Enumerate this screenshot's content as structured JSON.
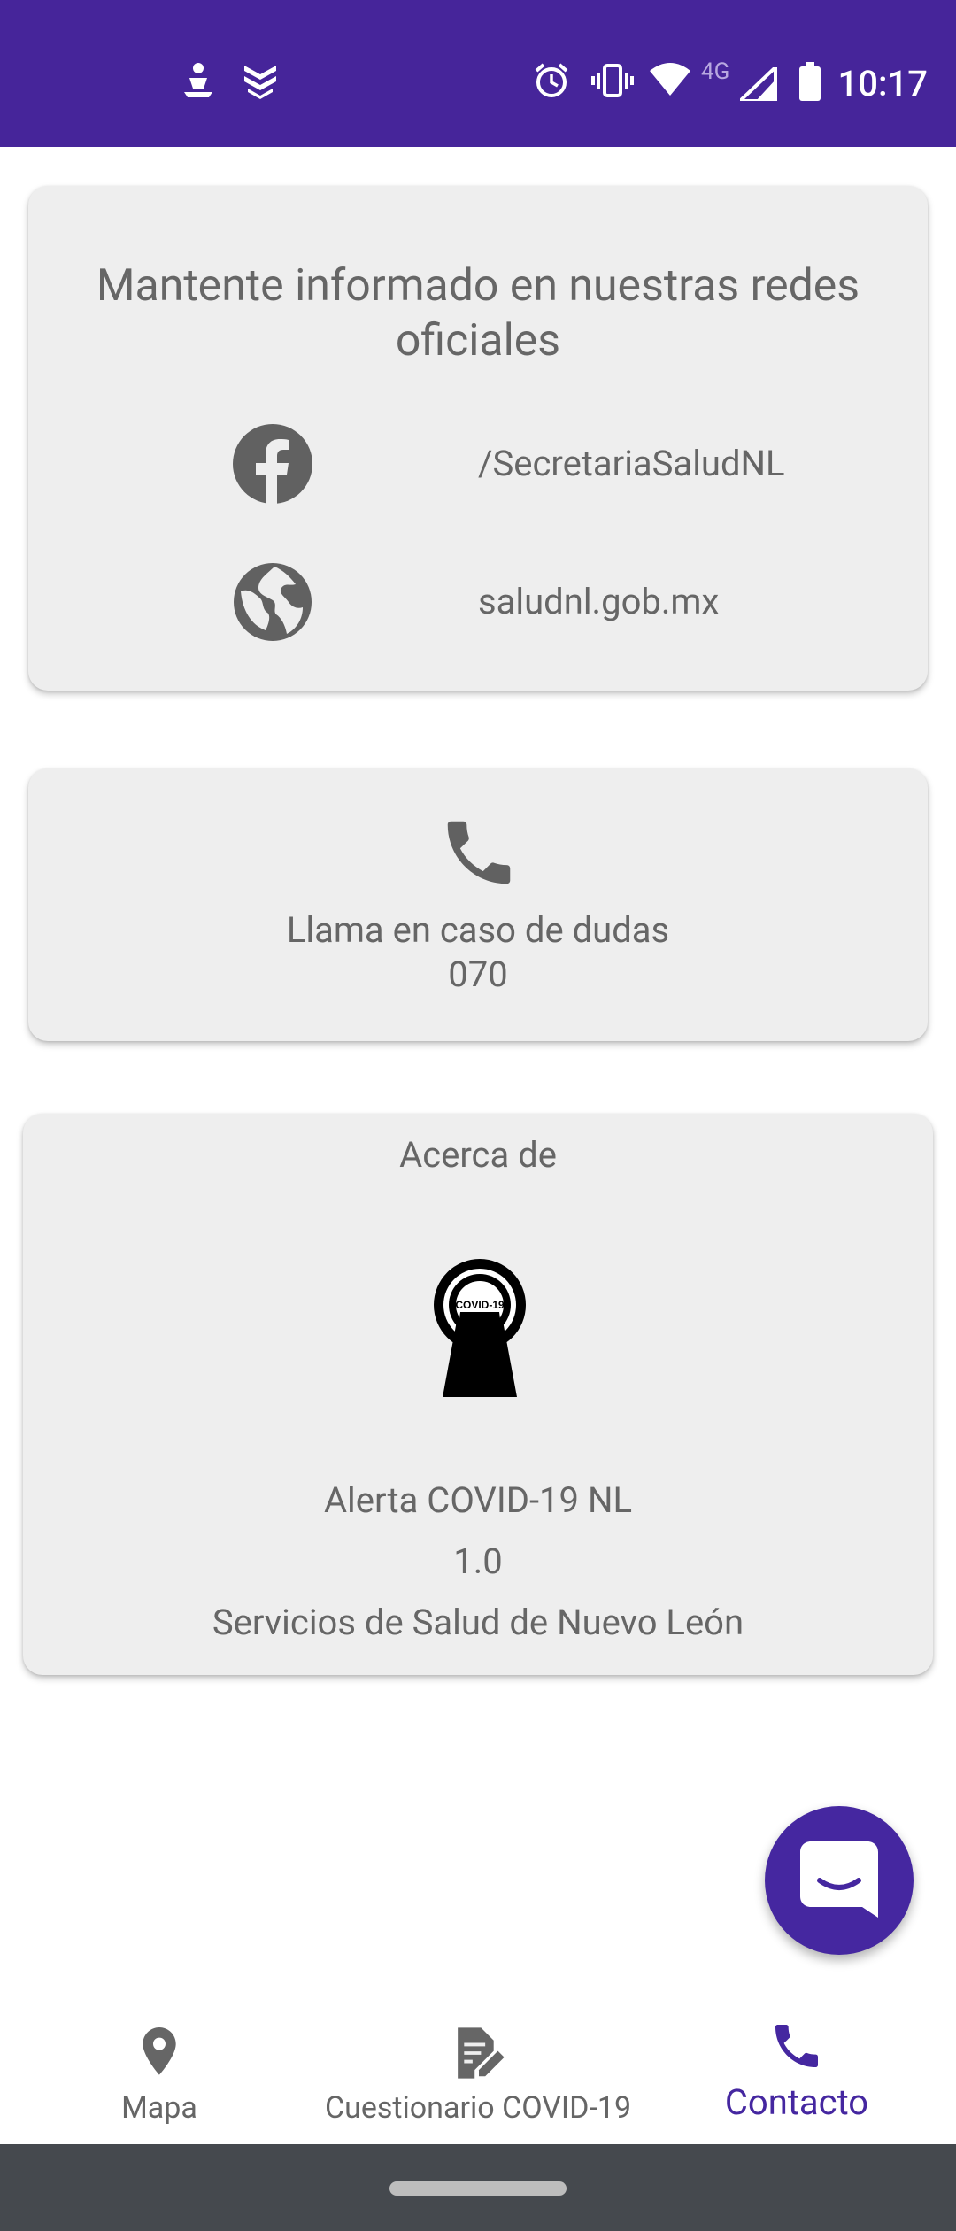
{
  "status_bar": {
    "time": "10:17",
    "network": "4G",
    "left_icons": [
      "person-download-icon",
      "shield-layers-icon"
    ],
    "right_icons": [
      "alarm-icon",
      "vibrate-icon",
      "wifi-icon",
      "signal-icon",
      "battery-icon"
    ]
  },
  "social_card": {
    "title": "Mantente informado en nuestras redes oficiales",
    "facebook": {
      "icon": "facebook-icon",
      "label": "/SecretariaSaludNL"
    },
    "website": {
      "icon": "globe-icon",
      "label": "saludnl.gob.mx"
    }
  },
  "phone_card": {
    "icon": "phone-icon",
    "label": "Llama en caso de dudas",
    "number": "070"
  },
  "about_card": {
    "title": "Acerca de",
    "logo_text": "COVID-19",
    "app_name": "Alerta COVID-19 NL",
    "version": "1.0",
    "organization": "Servicios de Salud de Nuevo León"
  },
  "fab": {
    "icon": "chat-icon"
  },
  "bottom_nav": {
    "items": [
      {
        "label": "Mapa",
        "icon": "map-pin-icon",
        "active": false
      },
      {
        "label": "Cuestionario COVID-19",
        "icon": "document-edit-icon",
        "active": false
      },
      {
        "label": "Contacto",
        "icon": "phone-icon",
        "active": true
      }
    ]
  },
  "colors": {
    "status_bar": "#46259a",
    "accent": "#4527a0",
    "card_bg": "#eeeeee",
    "text_gray": "#666666",
    "icon_gray": "#616161",
    "gesture_bar": "#45494e"
  }
}
